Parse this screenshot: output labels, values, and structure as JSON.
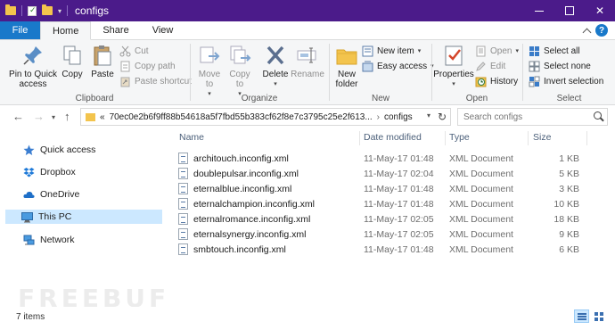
{
  "window": {
    "title": "configs",
    "accent": "#4b1b8a"
  },
  "tabs": [
    {
      "label": "File"
    },
    {
      "label": "Home"
    },
    {
      "label": "Share"
    },
    {
      "label": "View"
    }
  ],
  "ribbon": {
    "clipboard": {
      "label": "Clipboard",
      "pin": "Pin to Quick access",
      "copy": "Copy",
      "paste": "Paste",
      "cut": "Cut",
      "copy_path": "Copy path",
      "paste_shortcut": "Paste shortcut"
    },
    "organize": {
      "label": "Organize",
      "move_to": "Move to",
      "copy_to": "Copy to",
      "delete": "Delete",
      "rename": "Rename"
    },
    "new": {
      "label": "New",
      "new_folder": "New folder",
      "new_item": "New item",
      "easy_access": "Easy access"
    },
    "open": {
      "label": "Open",
      "properties": "Properties",
      "open": "Open",
      "edit": "Edit",
      "history": "History"
    },
    "select": {
      "label": "Select",
      "select_all": "Select all",
      "select_none": "Select none",
      "invert_selection": "Invert selection"
    }
  },
  "address": {
    "prefix": "«",
    "path": "70ec0e2b6f9ff88b54618a5f7fbd55b383cf62f8e7c3795c25e2f613...",
    "current": "configs"
  },
  "search": {
    "placeholder": "Search configs"
  },
  "nav": {
    "items": [
      {
        "label": "Quick access"
      },
      {
        "label": "Dropbox"
      },
      {
        "label": "OneDrive"
      },
      {
        "label": "This PC"
      },
      {
        "label": "Network"
      }
    ]
  },
  "columns": {
    "name": "Name",
    "date": "Date modified",
    "type": "Type",
    "size": "Size"
  },
  "files": [
    {
      "name": "architouch.inconfig.xml",
      "date": "11-May-17 01:48",
      "type": "XML Document",
      "size": "1 KB"
    },
    {
      "name": "doublepulsar.inconfig.xml",
      "date": "11-May-17 02:04",
      "type": "XML Document",
      "size": "5 KB"
    },
    {
      "name": "eternalblue.inconfig.xml",
      "date": "11-May-17 01:48",
      "type": "XML Document",
      "size": "3 KB"
    },
    {
      "name": "eternalchampion.inconfig.xml",
      "date": "11-May-17 01:48",
      "type": "XML Document",
      "size": "10 KB"
    },
    {
      "name": "eternalromance.inconfig.xml",
      "date": "11-May-17 02:05",
      "type": "XML Document",
      "size": "18 KB"
    },
    {
      "name": "eternalsynergy.inconfig.xml",
      "date": "11-May-17 02:05",
      "type": "XML Document",
      "size": "9 KB"
    },
    {
      "name": "smbtouch.inconfig.xml",
      "date": "11-May-17 01:48",
      "type": "XML Document",
      "size": "6 KB"
    }
  ],
  "status": {
    "count": "7 items"
  },
  "watermark": "FREEBUF"
}
